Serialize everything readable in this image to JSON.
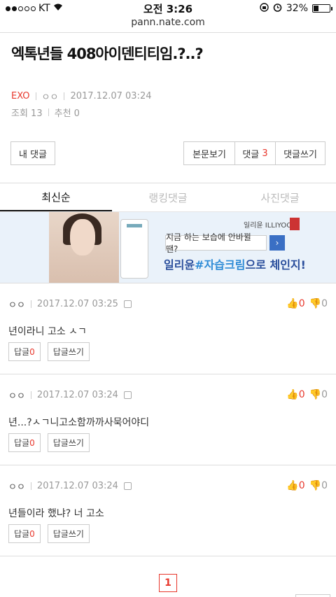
{
  "status_bar": {
    "carrier": "KT",
    "time": "오전 3:26",
    "battery": "32%",
    "battery_level": 0.32
  },
  "url": "pann.nate.com",
  "post": {
    "title": "엑톡년들 408아이덴티티임.?..?",
    "category": "EXO",
    "author": "ㅇㅇ",
    "date": "2017.12.07 03:24",
    "views": "조회 13",
    "recommend": "추천 0"
  },
  "buttons": {
    "my_comments": "내 댓글",
    "view_post": "본문보기",
    "comments": "댓글",
    "comment_count": "3",
    "write_comment": "댓글쓰기"
  },
  "tabs": [
    "최신순",
    "랭킹댓글",
    "사진댓글"
  ],
  "ad": {
    "brand": "일리윤 ILLIYOON",
    "line1": "지금 하는 보습에 안바뀔 땐?",
    "arrow": "›",
    "line2_a": "일리윤",
    "line2_hl": "#자습크림",
    "line2_b": "으로 체인지!"
  },
  "comments": [
    {
      "author": "ㅇㅇ",
      "date": "2017.12.07 03:25",
      "up": "0",
      "down": "0",
      "text": "년이라니 고소 ㅅㄱ",
      "reply_label": "답글",
      "reply_count": "0",
      "write_reply": "답글쓰기"
    },
    {
      "author": "ㅇㅇ",
      "date": "2017.12.07 03:24",
      "up": "0",
      "down": "0",
      "text": "년...?ㅅㄱ니고소함까까사묵어야디",
      "reply_label": "답글",
      "reply_count": "0",
      "write_reply": "답글쓰기"
    },
    {
      "author": "ㅇㅇ",
      "date": "2017.12.07 03:24",
      "up": "0",
      "down": "0",
      "text": "년들이라 했냐? 너 고소",
      "reply_label": "답글",
      "reply_count": "0",
      "write_reply": "답글쓰기"
    }
  ],
  "pagination": {
    "current": "1"
  },
  "colors": {
    "accent": "#e8382d",
    "ad_blue": "#2a4e9c"
  }
}
